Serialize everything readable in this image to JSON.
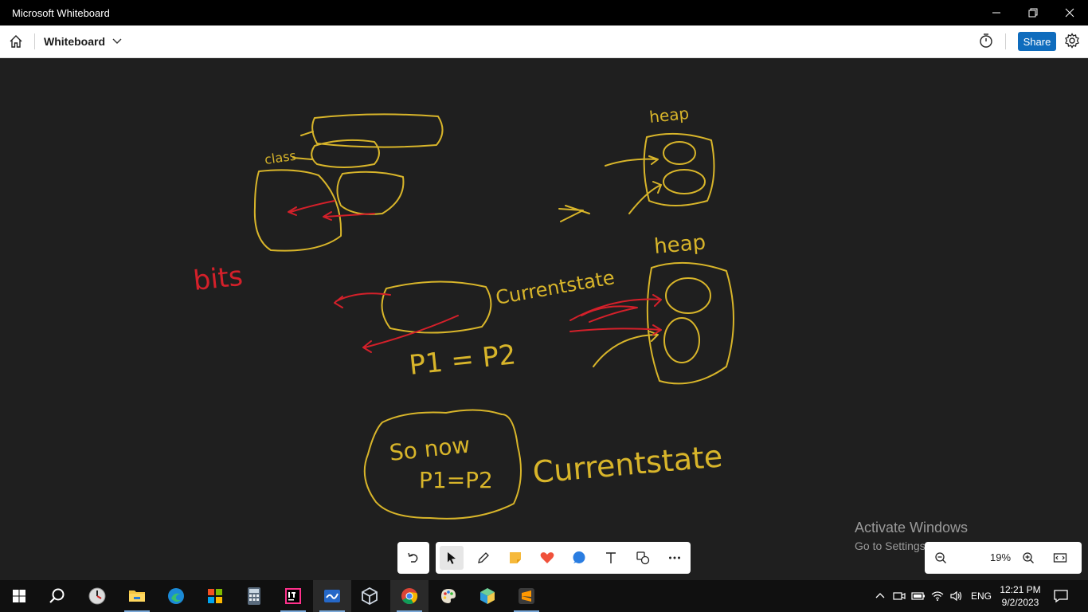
{
  "window": {
    "title": "Microsoft Whiteboard"
  },
  "header": {
    "board_title": "Whiteboard",
    "share_label": "Share"
  },
  "canvas_text": {
    "heap1": "heap",
    "heap2": "heap",
    "class": "class",
    "bits": "bits",
    "current_state_1": "Currentstate",
    "current_state_2": "Currentstate",
    "p1_eq_p2": "P1 = P2",
    "so_now": "So now",
    "so_now_eq": "P1=P2"
  },
  "activation": {
    "line1": "Activate Windows",
    "line2": "Go to Settings to activate Windows."
  },
  "zoom": {
    "value": "19%"
  },
  "taskbar": {
    "language": "ENG",
    "time": "12:21 PM",
    "date": "9/2/2023"
  },
  "colors": {
    "ink_yellow": "#d8b52a",
    "ink_red": "#d4202a",
    "share_blue": "#0f6cbd"
  }
}
